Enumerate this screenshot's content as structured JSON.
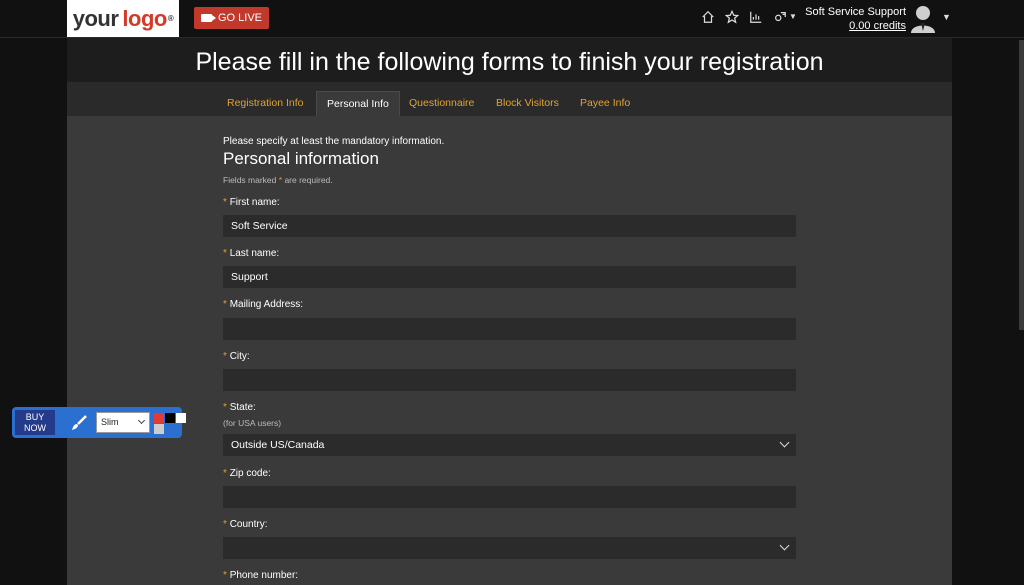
{
  "header": {
    "logo_text_1": "your",
    "logo_text_2": "logo",
    "logo_reg": "®",
    "golive_label": "GO LIVE",
    "user_name": "Soft Service Support",
    "credits": "0.00 credits",
    "icons": [
      "home-icon",
      "star-icon",
      "stats-icon",
      "settings-icon"
    ]
  },
  "page": {
    "heading": "Please fill in the following forms to finish your registration"
  },
  "tabs": [
    {
      "label": "Registration Info",
      "active": false
    },
    {
      "label": "Personal Info",
      "active": true
    },
    {
      "label": "Questionnaire",
      "active": false
    },
    {
      "label": "Block Visitors",
      "active": false
    },
    {
      "label": "Payee Info",
      "active": false
    }
  ],
  "form": {
    "intro": "Please specify at least the mandatory information.",
    "title": "Personal information",
    "note_prefix": "Fields marked",
    "note_suffix": "are required.",
    "star": "*",
    "fields": {
      "first_name": {
        "label": "First name:",
        "value": "Soft Service"
      },
      "last_name": {
        "label": "Last name:",
        "value": "Support"
      },
      "mailing_address": {
        "label": "Mailing Address:",
        "value": ""
      },
      "city": {
        "label": "City:",
        "value": ""
      },
      "state": {
        "label": "State:",
        "hint": "(for USA users)",
        "value": "Outside US/Canada"
      },
      "zip": {
        "label": "Zip code:",
        "value": ""
      },
      "country": {
        "label": "Country:",
        "value": ""
      },
      "phone": {
        "label": "Phone number:"
      }
    }
  },
  "widget": {
    "buy_now": "BUY NOW",
    "select_value": "Slim",
    "colors": [
      "#e53935",
      "#000000",
      "#ffffff",
      "#cccccc"
    ]
  },
  "colors": {
    "accent": "#e0a32e",
    "golive": "#c0392b",
    "widget": "#2b6fd0"
  }
}
